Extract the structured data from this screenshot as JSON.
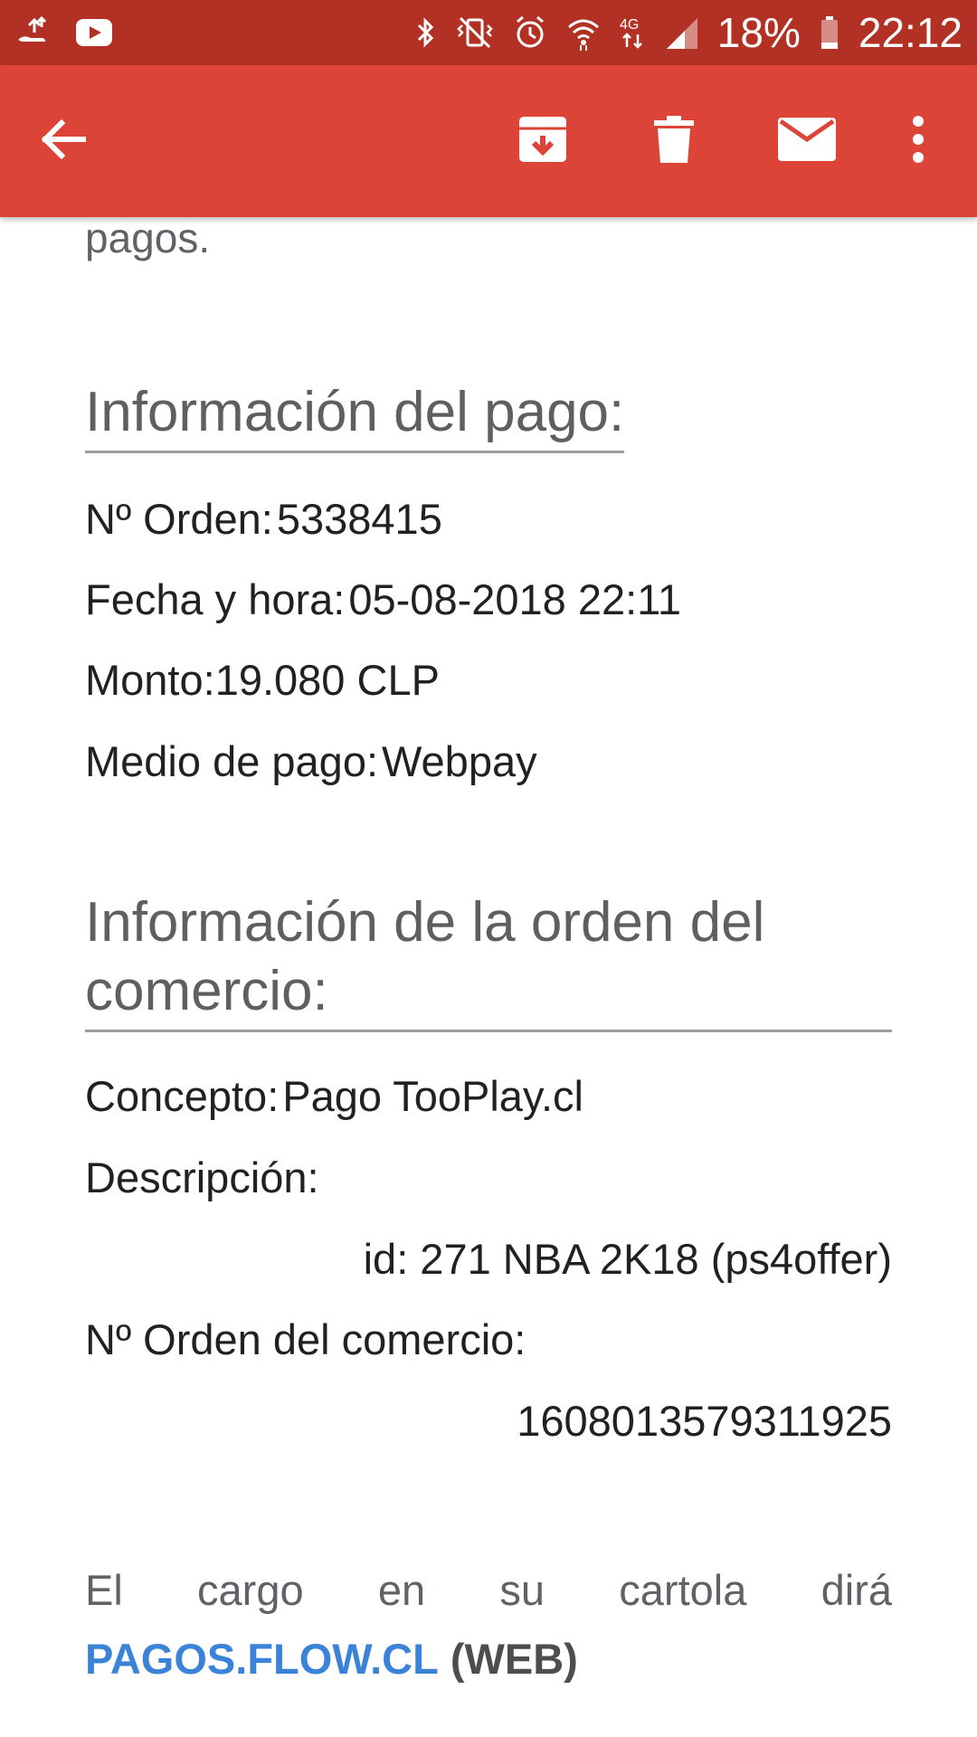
{
  "status_bar": {
    "battery": "18%",
    "time": "22:12",
    "network": "4G",
    "icons": [
      "upload-icon",
      "youtube-icon",
      "bluetooth-icon",
      "vibrate-icon",
      "alarm-icon",
      "wifi-icon",
      "signal-icon",
      "battery-icon"
    ]
  },
  "app_bar": {
    "actions": [
      "back-arrow-icon",
      "archive-icon",
      "delete-icon",
      "mail-icon",
      "more-vert-icon"
    ]
  },
  "email": {
    "fragment": "pagos.",
    "payment_section": {
      "title": "Información del pago:",
      "order_label": "Nº Orden:",
      "order_value": "5338415",
      "date_label": "Fecha y hora:",
      "date_value": "05-08-2018 22:11",
      "amount_label": "Monto:",
      "amount_value": "19.080 CLP",
      "method_label": "Medio de pago:",
      "method_value": "Webpay"
    },
    "merchant_section": {
      "title": "Información de la orden del comercio:",
      "concept_label": "Concepto:",
      "concept_value": "Pago TooPlay.cl",
      "description_label": "Descripción:",
      "description_value": "id: 271 NBA 2K18 (ps4offer)",
      "merchant_order_label": "Nº Orden del comercio:",
      "merchant_order_value": "1608013579311925"
    },
    "note": {
      "words": [
        "El",
        "cargo",
        "en",
        "su",
        "cartola",
        "dirá"
      ],
      "link": "PAGOS.FLOW.CL",
      "suffix": "(WEB)"
    }
  },
  "colors": {
    "status_bar": "#b23124",
    "app_bar": "#db4437",
    "link": "#3b82d9"
  }
}
